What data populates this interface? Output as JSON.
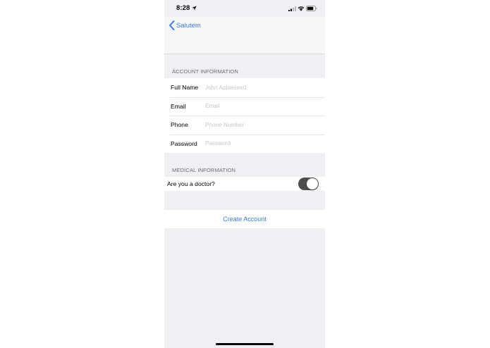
{
  "status_bar": {
    "time": "8:28",
    "icons": [
      "location-arrow-icon",
      "cellular-signal-icon",
      "wifi-icon",
      "battery-icon"
    ]
  },
  "nav": {
    "back_label": "Salutem"
  },
  "account_section": {
    "header": "ACCOUNT INFORMATION",
    "fields": [
      {
        "label": "Full Name",
        "placeholder": "John Appleseed",
        "value": ""
      },
      {
        "label": "Email",
        "placeholder": "Email",
        "value": ""
      },
      {
        "label": "Phone",
        "placeholder": "Phone Number",
        "value": ""
      },
      {
        "label": "Password",
        "placeholder": "Password",
        "value": ""
      }
    ]
  },
  "medical_section": {
    "header": "MEDICAL INFORMATION",
    "doctor_label": "Are you a doctor?",
    "doctor_toggle_on": true
  },
  "actions": {
    "create_account": "Create Account"
  },
  "colors": {
    "accent": "#2f7cf6",
    "background": "#efeff4",
    "toggle_track": "#4c4c4c"
  }
}
